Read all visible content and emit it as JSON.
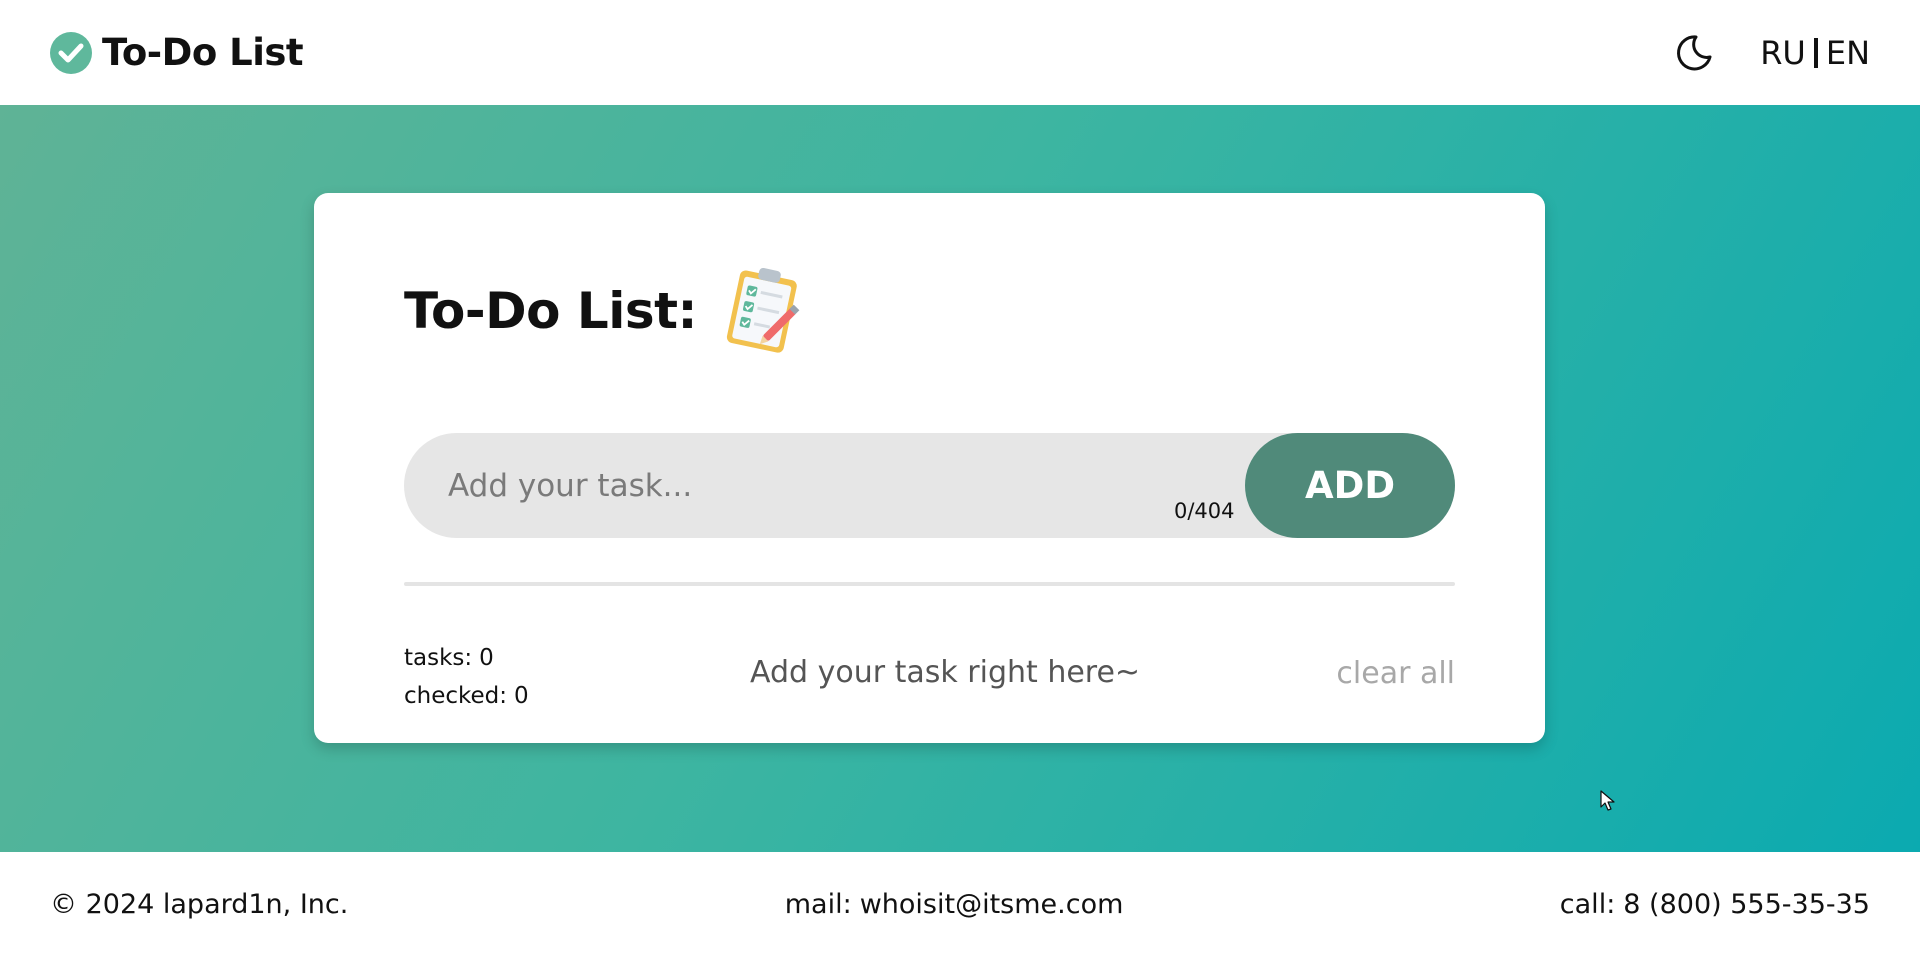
{
  "header": {
    "brand_title": "To-Do List",
    "lang_ru": "RU",
    "lang_en": "EN",
    "icons": {
      "logo": "check-circle-icon",
      "theme": "moon-icon"
    }
  },
  "card": {
    "title": "To-Do List:",
    "title_icon": "clipboard-checklist-icon",
    "input": {
      "value": "",
      "placeholder": "Add your task..."
    },
    "char_count": "0/404",
    "add_label": "ADD",
    "stats": {
      "tasks_label": "tasks:",
      "tasks_value": "0",
      "checked_label": "checked:",
      "checked_value": "0"
    },
    "hint": "Add your task right here~",
    "clear_all": "clear all"
  },
  "footer": {
    "copyright": "© 2024 lapard1n, Inc.",
    "mail_label": "mail:",
    "mail_value": "whoisit@itsme.com",
    "call_label": "call:",
    "call_value": "8 (800) 555-35-35"
  },
  "colors": {
    "accent": "#5fb89c",
    "add_button": "#508a7a",
    "gradient_start": "#5fb396",
    "gradient_end": "#0baab0",
    "input_bg": "#e6e6e6",
    "muted_text": "#a8a8a8"
  }
}
